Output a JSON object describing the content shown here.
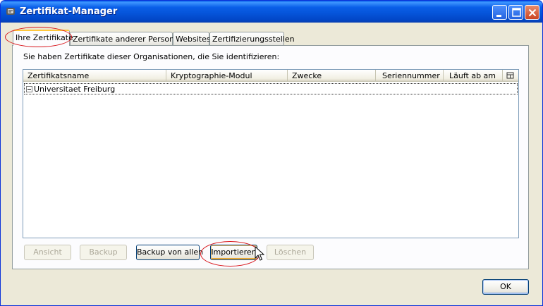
{
  "window": {
    "title": "Zertifikat-Manager"
  },
  "tabs": [
    {
      "label": "Ihre Zertifikate",
      "active": true
    },
    {
      "label": "Zertifikate anderer Personen",
      "active": false
    },
    {
      "label": "Websites",
      "active": false
    },
    {
      "label": "Zertifizierungsstellen",
      "active": false
    }
  ],
  "panel": {
    "info_text": "Sie haben Zertifikate dieser Organisationen, die Sie identifizieren:",
    "columns": [
      "Zertifikatsname",
      "Kryptographie-Modul",
      "Zwecke",
      "Seriennummer",
      "Läuft ab am"
    ],
    "rows": [
      {
        "label": "Universitaet Freiburg",
        "expanded": true
      }
    ]
  },
  "buttons": {
    "view": "Ansicht",
    "backup": "Backup",
    "backup_all": "Backup von allen",
    "import": "Importieren",
    "delete": "Löschen",
    "ok": "OK"
  },
  "icons": {
    "app": "certificate-manager-icon",
    "column_picker": "column-picker-icon",
    "cursor": "mouse-pointer"
  },
  "colors": {
    "titlebar": "#0a5fe8",
    "highlight": "#d8141a",
    "dialog_bg": "#ece9d8"
  }
}
